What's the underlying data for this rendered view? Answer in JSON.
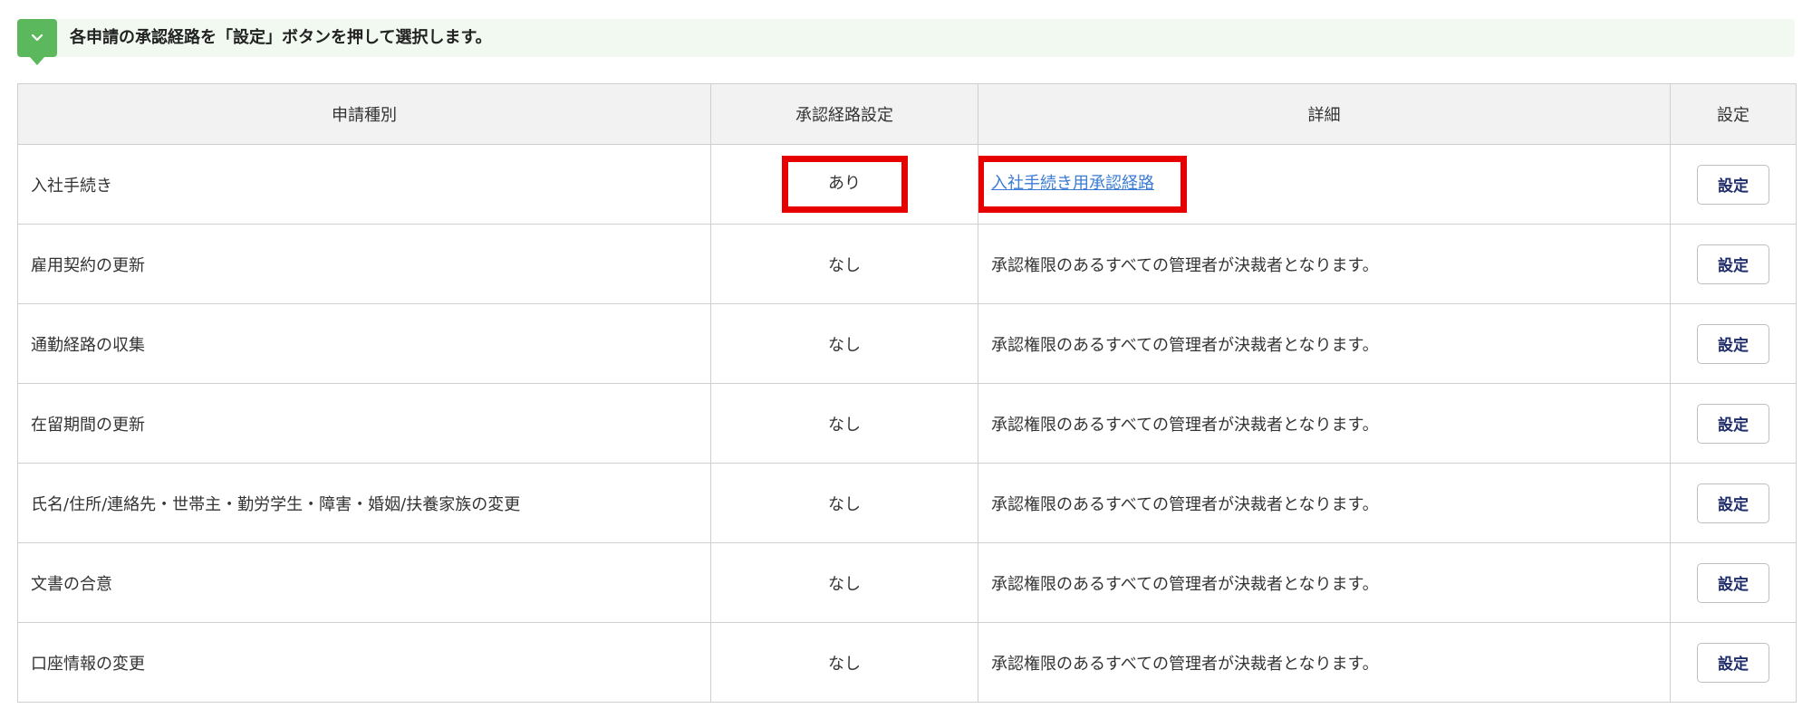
{
  "notice": {
    "text": "各申請の承認経路を「設定」ボタンを押して選択します。"
  },
  "table": {
    "headers": [
      "申請種別",
      "承認経路設定",
      "詳細",
      "設定"
    ],
    "rows": [
      {
        "type": "入社手続き",
        "status": "あり",
        "detail": "入社手続き用承認経路",
        "action": "設定"
      },
      {
        "type": "雇用契約の更新",
        "status": "なし",
        "detail": "承認権限のあるすべての管理者が決裁者となります。",
        "action": "設定"
      },
      {
        "type": "通勤経路の収集",
        "status": "なし",
        "detail": "承認権限のあるすべての管理者が決裁者となります。",
        "action": "設定"
      },
      {
        "type": "在留期間の更新",
        "status": "なし",
        "detail": "承認権限のあるすべての管理者が決裁者となります。",
        "action": "設定"
      },
      {
        "type": "氏名/住所/連絡先・世帯主・勤労学生・障害・婚姻/扶養家族の変更",
        "status": "なし",
        "detail": "承認権限のあるすべての管理者が決裁者となります。",
        "action": "設定"
      },
      {
        "type": "文書の合意",
        "status": "なし",
        "detail": "承認権限のあるすべての管理者が決裁者となります。",
        "action": "設定"
      },
      {
        "type": "口座情報の変更",
        "status": "なし",
        "detail": "承認権限のあるすべての管理者が決裁者となります。",
        "action": "設定"
      }
    ]
  },
  "colors": {
    "accent_green": "#5cb85c",
    "highlight_red": "#e60000",
    "link_blue": "#3a7bd5",
    "button_text": "#1f2d6b"
  },
  "icons": {
    "notice_badge": "chevron-down-icon"
  }
}
